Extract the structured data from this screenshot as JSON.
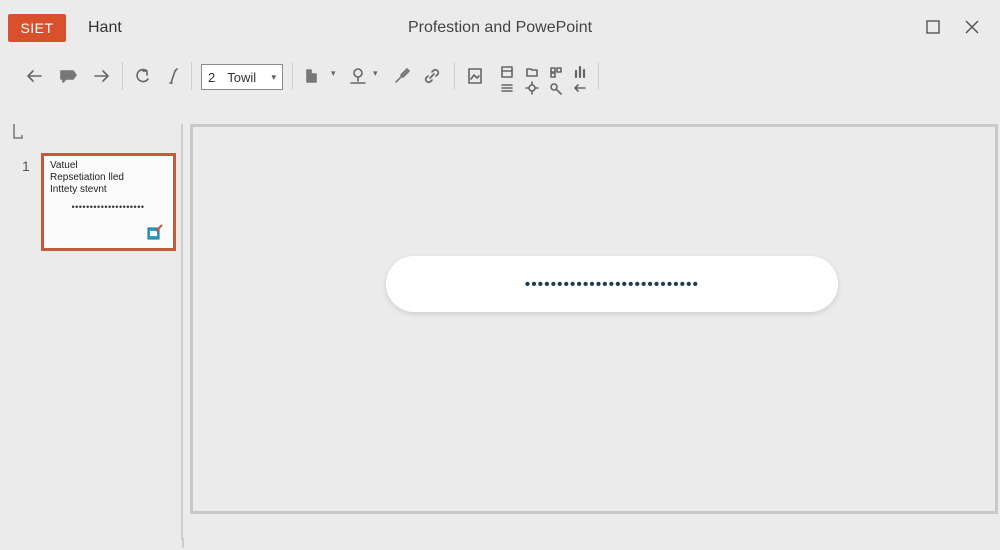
{
  "titlebar": {
    "app_badge": "SIET",
    "menu_item": "Hant",
    "window_title": "Profestion and PowePoint"
  },
  "toolbar": {
    "font_size": "2",
    "font_name": "Towil",
    "icons": [
      "back-arrow-icon",
      "comment-icon",
      "forward-arrow-icon",
      "undo-icon",
      "pen-icon",
      "chart-icon",
      "person-icon",
      "paint-brush-icon",
      "link-icon",
      "image-icon",
      "layout-icon",
      "folder-icon",
      "settings-icon",
      "bar-chart-icon",
      "list-icon"
    ]
  },
  "slide_panel": {
    "marker_icon": "hook-icon",
    "slides": [
      {
        "number": "1",
        "lines": [
          "Vatuel",
          "Repsetiation lled",
          "Inttety stevnt"
        ],
        "dots": "••••••••••••••••••••",
        "icon": "edit-image-icon"
      }
    ]
  },
  "canvas": {
    "textbox_content": "•••••••••••••••••••••••••••"
  }
}
